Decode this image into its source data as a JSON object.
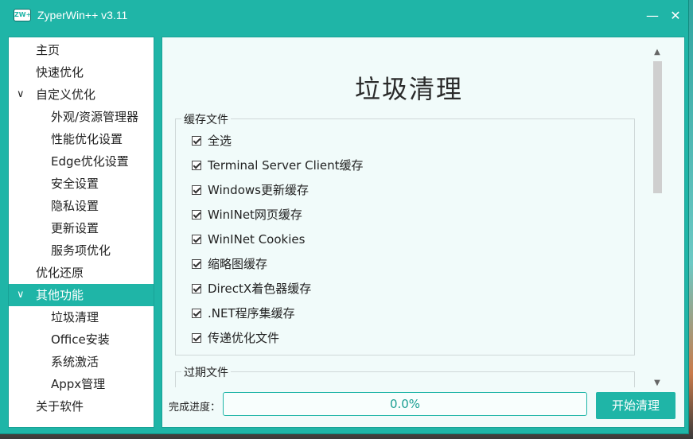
{
  "window": {
    "logo_text": "ZW+",
    "title": "ZyperWin++ v3.11",
    "minimize_glyph": "—",
    "close_glyph": "✕"
  },
  "sidebar": {
    "items": [
      {
        "label": "主页",
        "level": 0
      },
      {
        "label": "快速优化",
        "level": 0
      },
      {
        "label": "自定义优化",
        "level": 0,
        "expanded": true,
        "chevron": "∨"
      },
      {
        "label": "外观/资源管理器",
        "level": 1
      },
      {
        "label": "性能优化设置",
        "level": 1
      },
      {
        "label": "Edge优化设置",
        "level": 1
      },
      {
        "label": "安全设置",
        "level": 1
      },
      {
        "label": "隐私设置",
        "level": 1
      },
      {
        "label": "更新设置",
        "level": 1
      },
      {
        "label": "服务项优化",
        "level": 1
      },
      {
        "label": "优化还原",
        "level": 0
      },
      {
        "label": "其他功能",
        "level": 0,
        "expanded": true,
        "active": true,
        "chevron": "∨"
      },
      {
        "label": "垃圾清理",
        "level": 1
      },
      {
        "label": "Office安装",
        "level": 1
      },
      {
        "label": "系统激活",
        "level": 1
      },
      {
        "label": "Appx管理",
        "level": 1
      },
      {
        "label": "关于软件",
        "level": 0
      }
    ]
  },
  "main": {
    "title": "垃圾清理",
    "cache_group": {
      "label": "缓存文件",
      "items": [
        {
          "label": "全选",
          "checked": true
        },
        {
          "label": "Terminal Server Client缓存",
          "checked": true
        },
        {
          "label": "Windows更新缓存",
          "checked": true
        },
        {
          "label": "WinINet网页缓存",
          "checked": true
        },
        {
          "label": "WinINet Cookies",
          "checked": true
        },
        {
          "label": "缩略图缓存",
          "checked": true
        },
        {
          "label": "DirectX着色器缓存",
          "checked": true
        },
        {
          "label": ".NET程序集缓存",
          "checked": true
        },
        {
          "label": "传递优化文件",
          "checked": true
        }
      ]
    },
    "expired_group": {
      "label": "过期文件"
    },
    "scrollbar": {
      "up_glyph": "▲",
      "down_glyph": "▼"
    },
    "progress": {
      "label": "完成进度：",
      "value": 0.0,
      "text": "0.0%"
    },
    "start_button": "开始清理"
  },
  "colors": {
    "accent": "#1fb5a7",
    "panel_bg": "#f1fbfa"
  }
}
